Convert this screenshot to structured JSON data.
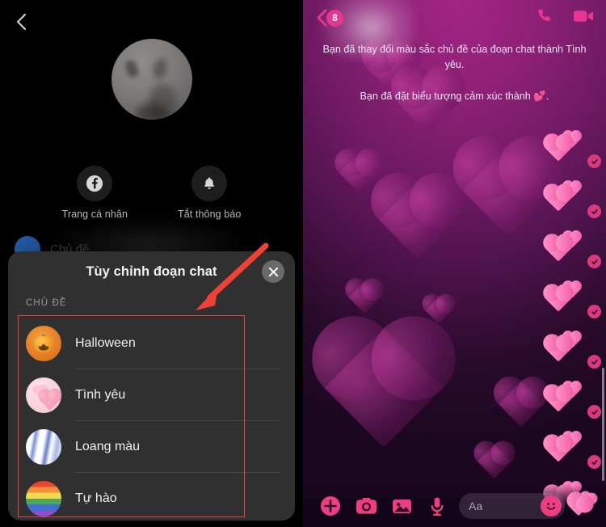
{
  "left_panel": {
    "back_icon": "chevron-left-icon",
    "profile_photo": "profile-avatar",
    "quick_actions": [
      {
        "icon": "facebook-icon",
        "label": "Trang cá nhân"
      },
      {
        "icon": "bell-icon",
        "label": "Tắt thông báo"
      }
    ],
    "obscured_row_text": "Chủ đề",
    "sheet": {
      "title": "Tùy chỉnh đoạn chat",
      "close_icon": "close-icon",
      "section_label": "CHỦ ĐỀ",
      "themes": [
        {
          "name": "Halloween",
          "avatar": "pumpkin-avatar"
        },
        {
          "name": "Tình yêu",
          "avatar": "hearts-avatar"
        },
        {
          "name": "Loang màu",
          "avatar": "tiedye-avatar"
        },
        {
          "name": "Tự hào",
          "avatar": "rainbow-avatar"
        }
      ]
    },
    "annotation": {
      "box_color": "#e8453c",
      "arrow_color": "#ef4136"
    }
  },
  "right_panel": {
    "header": {
      "back_icon": "chevron-left-icon",
      "unread_badge": "8",
      "call_icon": "phone-icon",
      "video_icon": "video-camera-icon"
    },
    "system_messages": [
      "Bạn đã thay đổi màu sắc chủ đề của đoạn chat thành Tình yêu.",
      "Bạn đã đặt biểu tượng cảm xúc thành 💕."
    ],
    "sticker_messages": [
      {
        "sticker": "hearts-sticker",
        "status_icon": "seen-check-icon"
      },
      {
        "sticker": "hearts-sticker",
        "status_icon": "seen-check-icon"
      },
      {
        "sticker": "hearts-sticker",
        "status_icon": "seen-check-icon"
      },
      {
        "sticker": "hearts-sticker",
        "status_icon": "seen-check-icon"
      },
      {
        "sticker": "hearts-sticker",
        "status_icon": "seen-check-icon"
      },
      {
        "sticker": "hearts-sticker",
        "status_icon": "seen-check-icon"
      },
      {
        "sticker": "hearts-sticker",
        "status_icon": "seen-check-icon"
      },
      {
        "sticker": "hearts-sticker",
        "status_icon": "seen-check-icon"
      }
    ],
    "composer": {
      "plus_icon": "plus-circle-icon",
      "camera_icon": "camera-icon",
      "gallery_icon": "image-icon",
      "mic_icon": "microphone-icon",
      "input_placeholder": "Aa",
      "emoji_icon": "smiley-icon",
      "sticker_icon": "hearts-sticker-icon"
    },
    "theme_colors": {
      "accent": "#ef3d82",
      "background_top": "#a32585",
      "background_bottom": "#1b0720"
    }
  }
}
